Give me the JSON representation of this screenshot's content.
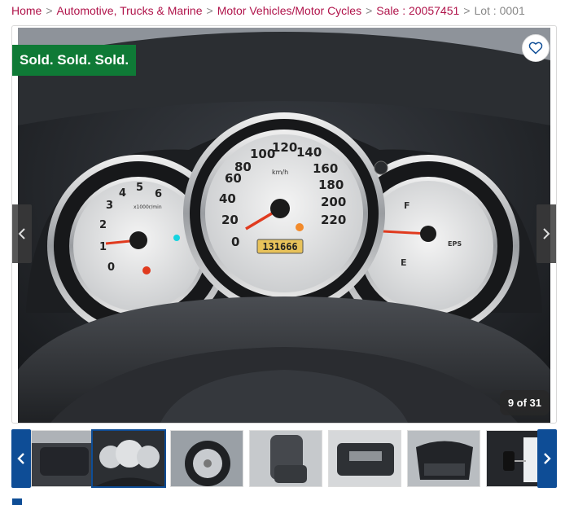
{
  "breadcrumb": {
    "items": [
      "Home",
      "Automotive, Trucks & Marine",
      "Motor Vehicles/Motor Cycles",
      "Sale : 20057451"
    ],
    "current": "Lot : 0001",
    "separator": ">"
  },
  "viewer": {
    "sold_label": "Sold. Sold. Sold.",
    "counter": "9 of 31",
    "odometer": "131666",
    "eps_label": "EPS",
    "fuel_full": "F",
    "fuel_empty": "E",
    "tach_unit": "x1000r/min",
    "speed_unit": "km/h"
  },
  "gauges": {
    "speed_ticks": [
      "0",
      "20",
      "40",
      "60",
      "80",
      "100",
      "120",
      "140",
      "160",
      "180",
      "200",
      "220"
    ],
    "tach_ticks": [
      "0",
      "1",
      "2",
      "3",
      "4",
      "5",
      "6"
    ]
  },
  "thumbnails": {
    "items": [
      {
        "name": "thumb-rear-seats",
        "active": false
      },
      {
        "name": "thumb-dashboard",
        "active": true
      },
      {
        "name": "thumb-wheel",
        "active": false
      },
      {
        "name": "thumb-driver-seat",
        "active": false
      },
      {
        "name": "thumb-door-panel",
        "active": false
      },
      {
        "name": "thumb-boot",
        "active": false
      },
      {
        "name": "thumb-keys-docs",
        "active": false
      }
    ]
  },
  "colors": {
    "accent": "#b0134a",
    "sold_green": "#0f7a36",
    "nav_blue": "#0e4d96"
  }
}
